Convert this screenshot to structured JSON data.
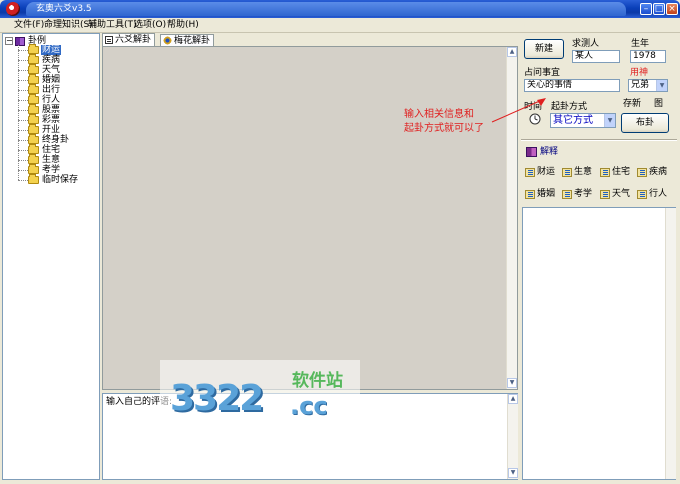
{
  "window": {
    "title": "玄奥六爻v3.5",
    "min_label": "–",
    "max_label": "□",
    "close_label": "×"
  },
  "menu": [
    "文件(F)",
    "命理知识(S)",
    "辅助工具(T)",
    "选项(O)",
    "帮助(H)"
  ],
  "tree": {
    "root_label": "卦例",
    "items": [
      "财运",
      "疾病",
      "天气",
      "婚姻",
      "出行",
      "行人",
      "股票",
      "彩票",
      "开业",
      "终身卦",
      "住宅",
      "生意",
      "考学",
      "临时保存"
    ],
    "selected_index": 0
  },
  "tabs": [
    "六爻解卦",
    "梅花解卦"
  ],
  "comment": {
    "placeholder": "输入自己的评语:"
  },
  "form": {
    "new_button": "新建",
    "person_label": "求测人",
    "person_value": "某人",
    "birth_year_label": "生年",
    "birth_year_value": "1978",
    "matter_label": "占问事宜",
    "matter_value": "关心的事情",
    "yongshen_label": "用神",
    "yongshen_value": "兄弟",
    "time_label": "时间",
    "method_label": "起卦方式",
    "method_value": "其它方式",
    "save_label": "存新",
    "chart_label": "图",
    "cast_button": "布卦"
  },
  "interpretation": {
    "title": "解释",
    "categories": [
      "财运",
      "生意",
      "住宅",
      "疾病",
      "婚姻",
      "考学",
      "天气",
      "行人"
    ]
  },
  "annotation": {
    "line1": "输入相关信息和",
    "line2": "起卦方式就可以了"
  },
  "watermark": {
    "number": "3322",
    "site_cn": "软件站",
    "domain": ".cc"
  },
  "colors": {
    "titlebar": "#0a3fb8",
    "selection": "#316ac5",
    "annotation": "#e02020",
    "yongshen_label": "#e02020",
    "method_text": "#0000c0"
  }
}
